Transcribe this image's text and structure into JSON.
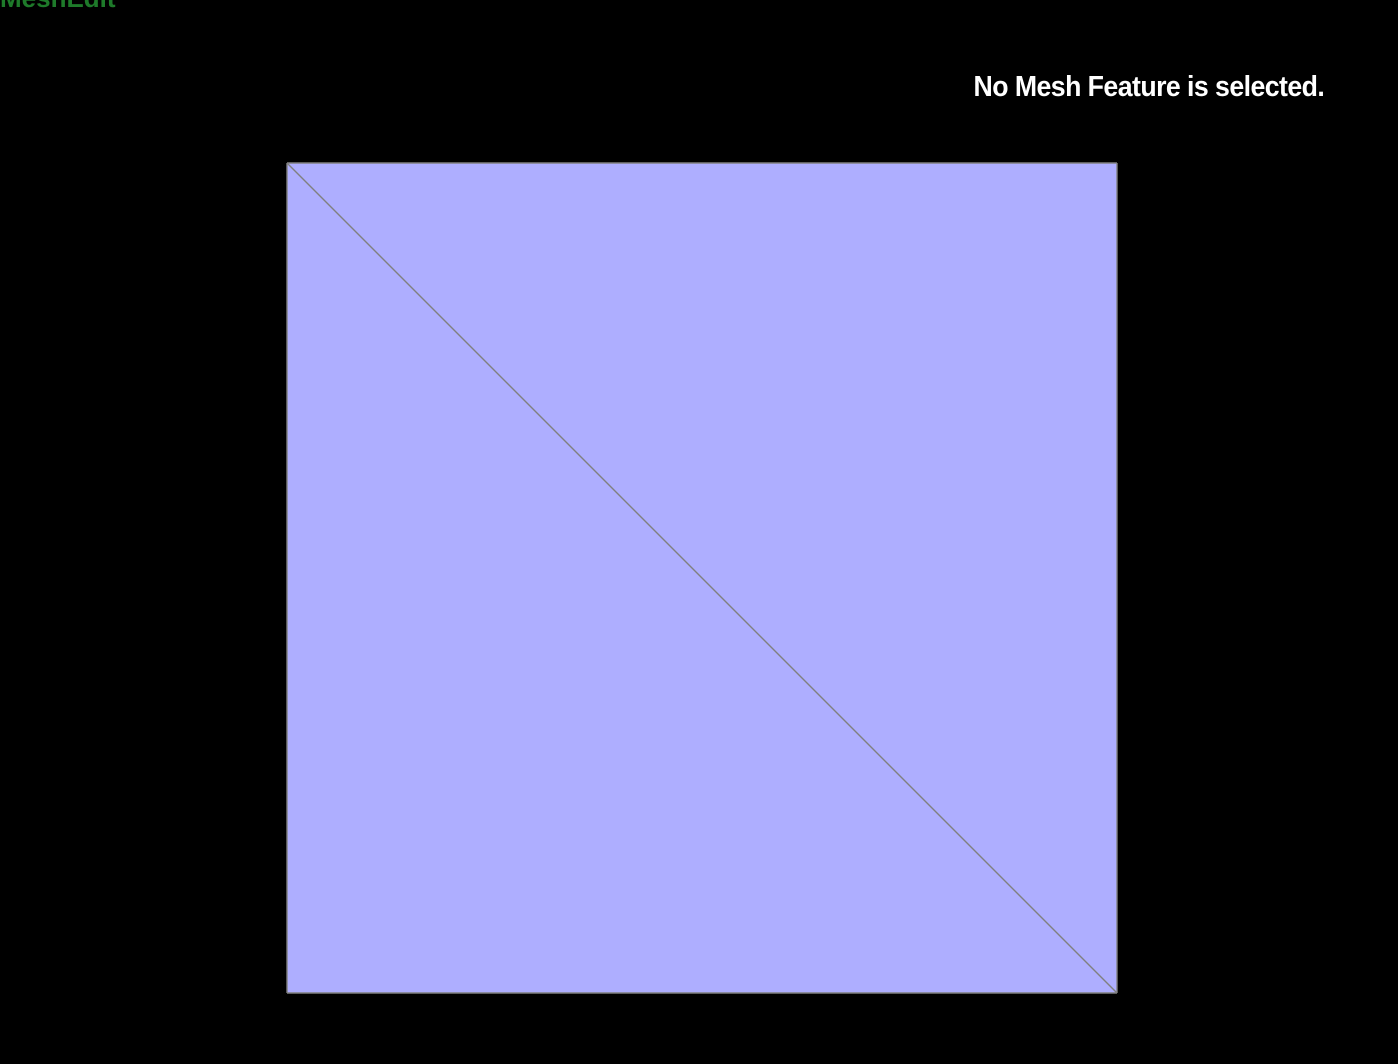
{
  "app": {
    "title": "MeshEdit"
  },
  "status": {
    "message": "No Mesh Feature is selected."
  },
  "mesh": {
    "face_color": "#aeaeff",
    "edge_color": "#808080",
    "background_color": "#000000"
  }
}
